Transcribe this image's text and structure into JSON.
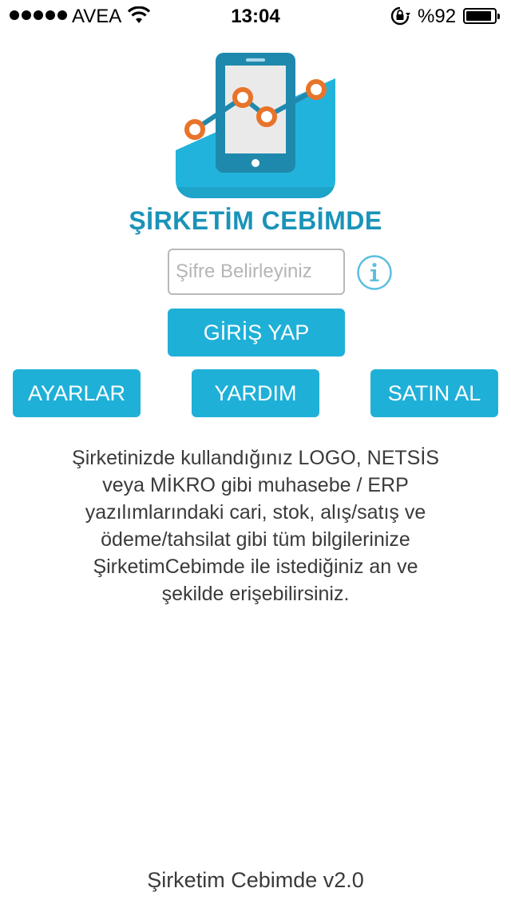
{
  "status_bar": {
    "carrier": "AVEA",
    "time": "13:04",
    "battery_percent": "%92",
    "battery_level": 0.92,
    "icons": [
      "signal-dots-icon",
      "wifi-icon",
      "orientation-lock-icon",
      "battery-icon"
    ]
  },
  "app": {
    "title": "ŞİRKETİM CEBİMDE",
    "icon": "app-logo-icon",
    "colors": {
      "accent": "#1fb0d8",
      "title": "#1a93b8",
      "phone": "#1f89ad",
      "chart_dot": "#e8742a"
    }
  },
  "login": {
    "password_placeholder": "Şifre Belirleyiniz",
    "password_value": "",
    "info_icon": "info-icon",
    "login_label": "GİRİŞ YAP"
  },
  "actions": {
    "settings_label": "AYARLAR",
    "help_label": "YARDIM",
    "buy_label": "SATIN AL"
  },
  "description": {
    "lines": [
      "Şirketinizde kullandığınız LOGO, NETSİS",
      "veya MİKRO gibi muhasebe / ERP",
      "yazılımlarındaki cari, stok, alış/satış ve",
      "ödeme/tahsilat gibi tüm bilgilerinize",
      "ŞirketimCebimde ile istediğiniz an ve",
      "şekilde erişebilirsiniz."
    ]
  },
  "footer": {
    "version": "Şirketim Cebimde v2.0"
  }
}
